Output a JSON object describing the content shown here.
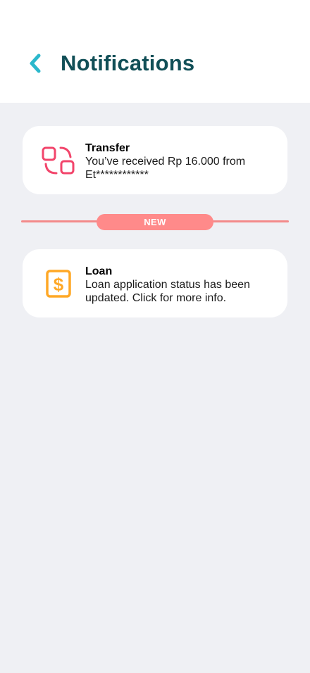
{
  "header": {
    "title": "Notifications"
  },
  "notifications": [
    {
      "icon": "transfer-icon",
      "title": "Transfer",
      "body": "You’ve received Rp 16.000 from Et************"
    },
    {
      "icon": "loan-dollar-icon",
      "title": "Loan",
      "body": "Loan application status has been updated. Click for more info."
    }
  ],
  "divider": {
    "label": "NEW"
  },
  "colors": {
    "title": "#114F57",
    "back_arrow": "#2BB8CC",
    "transfer_icon": "#F2456B",
    "loan_icon": "#FFA826",
    "new_badge": "#FF8A8A",
    "background": "#EFF0F4"
  }
}
